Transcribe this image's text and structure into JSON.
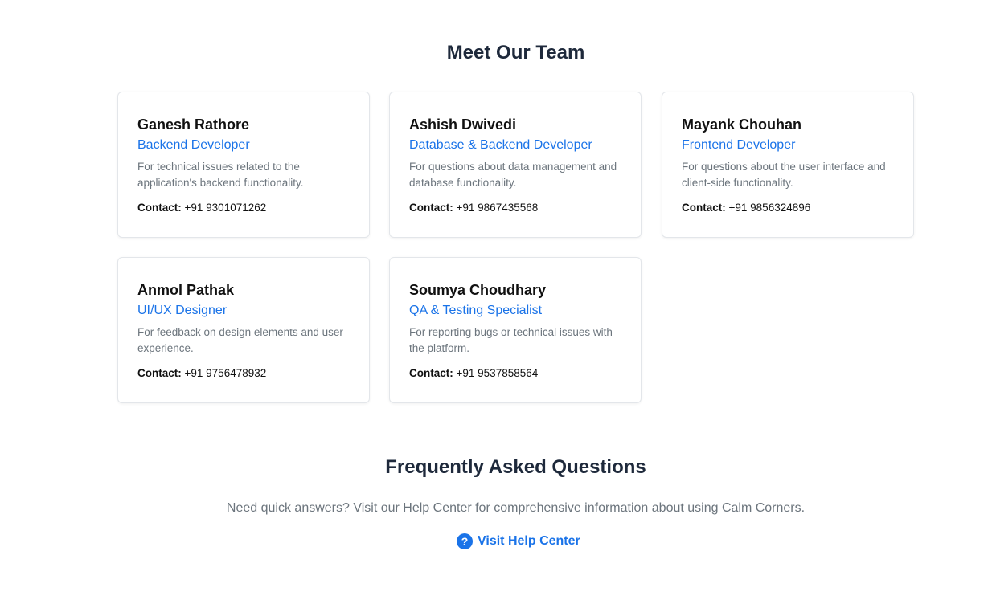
{
  "team": {
    "title": "Meet Our Team",
    "contact_label": "Contact:",
    "members": [
      {
        "name": "Ganesh Rathore",
        "role": "Backend Developer",
        "description": "For technical issues related to the application's backend functionality.",
        "phone": "+91 9301071262"
      },
      {
        "name": "Ashish Dwivedi",
        "role": "Database & Backend Developer",
        "description": "For questions about data management and database functionality.",
        "phone": "+91 9867435568"
      },
      {
        "name": "Mayank Chouhan",
        "role": "Frontend Developer",
        "description": "For questions about the user interface and client-side functionality.",
        "phone": "+91 9856324896"
      },
      {
        "name": "Anmol Pathak",
        "role": "UI/UX Designer",
        "description": "For feedback on design elements and user experience.",
        "phone": "+91 9756478932"
      },
      {
        "name": "Soumya Choudhary",
        "role": "QA & Testing Specialist",
        "description": "For reporting bugs or technical issues with the platform.",
        "phone": "+91 9537858564"
      }
    ]
  },
  "faq": {
    "title": "Frequently Asked Questions",
    "text": "Need quick answers? Visit our Help Center for comprehensive information about using Calm Corners.",
    "link_label": "Visit Help Center",
    "link_icon": "question-circle-icon"
  },
  "colors": {
    "accent": "#1a73e8",
    "heading": "#1e293b",
    "muted": "#6c757d"
  }
}
